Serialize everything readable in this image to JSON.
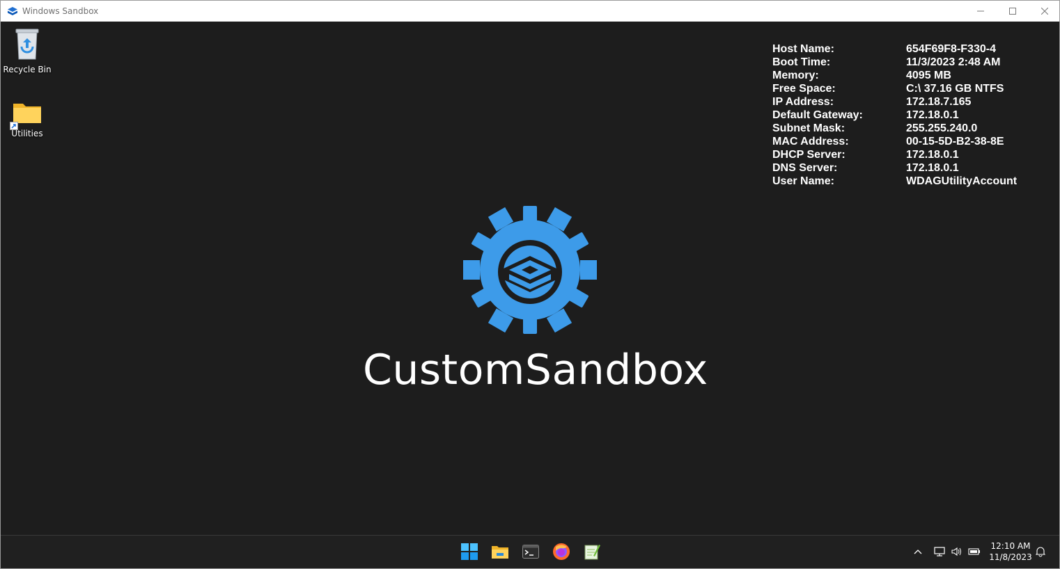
{
  "window": {
    "title": "Windows Sandbox"
  },
  "desktop": {
    "icons": [
      {
        "label": "Recycle Bin"
      },
      {
        "label": "Utilities"
      }
    ]
  },
  "info": {
    "rows": [
      {
        "key": "Host Name:",
        "value": "654F69F8-F330-4"
      },
      {
        "key": "Boot Time:",
        "value": "11/3/2023 2:48 AM"
      },
      {
        "key": "Memory:",
        "value": "4095 MB"
      },
      {
        "key": "Free Space:",
        "value": "C:\\ 37.16 GB NTFS"
      },
      {
        "key": "IP Address:",
        "value": "172.18.7.165"
      },
      {
        "key": "Default Gateway:",
        "value": "172.18.0.1"
      },
      {
        "key": "Subnet Mask:",
        "value": "255.255.240.0"
      },
      {
        "key": "MAC Address:",
        "value": "00-15-5D-B2-38-8E"
      },
      {
        "key": "DHCP Server:",
        "value": "172.18.0.1"
      },
      {
        "key": "DNS Server:",
        "value": "172.18.0.1"
      },
      {
        "key": "User Name:",
        "value": "WDAGUtilityAccount"
      }
    ]
  },
  "logo": {
    "text": "CustomSandbox",
    "accent_color": "#3d9be9"
  },
  "taskbar": {
    "apps": [
      "windows-start-icon",
      "file-explorer-icon",
      "terminal-icon",
      "firefox-icon",
      "notepad-plus-icon"
    ],
    "clock": {
      "time": "12:10 AM",
      "date": "11/8/2023"
    }
  }
}
